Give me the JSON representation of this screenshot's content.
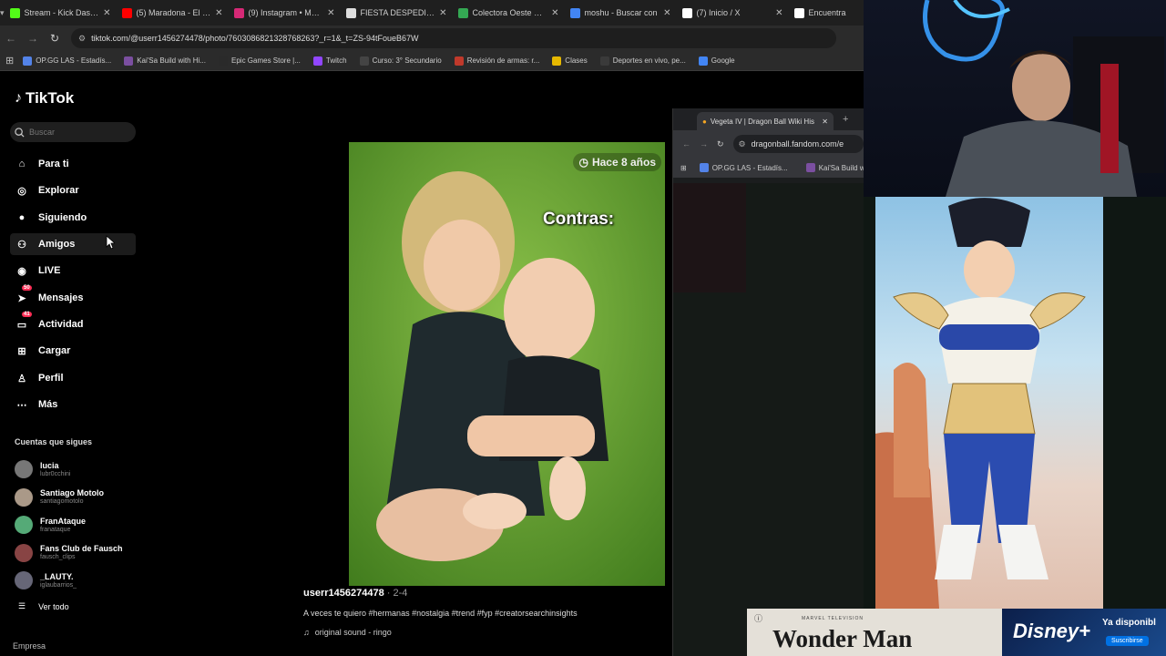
{
  "browser": {
    "tabs": [
      {
        "title": "Stream - Kick Dashbo",
        "icon": "kick-icon",
        "color": "#53fc18"
      },
      {
        "title": "(5) Maradona - El me",
        "icon": "youtube-icon",
        "color": "#ff0000"
      },
      {
        "title": "(9) Instagram • Mens",
        "icon": "instagram-icon",
        "color": "#d62976"
      },
      {
        "title": "FIESTA DESPEDIDA DE",
        "icon": "feather-icon",
        "color": "#dddddd"
      },
      {
        "title": "Colectora Oeste Ram",
        "icon": "maps-pin-icon",
        "color": "#34a853"
      },
      {
        "title": "moshu - Buscar con",
        "icon": "google-icon",
        "color": "#4285f4"
      },
      {
        "title": "(7) Inicio / X",
        "icon": "x-icon",
        "color": "#ffffff"
      },
      {
        "title": "Encuentra",
        "icon": "tiktok-icon",
        "color": "#ffffff"
      }
    ],
    "url": "tiktok.com/@userr1456274478/photo/7603086821328768263?_r=1&_t=ZS-94tFoueB67W",
    "bookmarks": [
      "OP.GG LAS - Estadís...",
      "Kai'Sa Build with Hi...",
      "Epic Games Store |...",
      "Twitch",
      "Curso: 3° Secundario",
      "Revisión de armas: r...",
      "Clases",
      "Deportes en vivo, pe...",
      "Google"
    ]
  },
  "tiktok": {
    "logo": "TikTok",
    "search_placeholder": "Buscar",
    "nav": [
      {
        "label": "Para ti",
        "icon": "home-icon"
      },
      {
        "label": "Explorar",
        "icon": "compass-icon"
      },
      {
        "label": "Siguiendo",
        "icon": "avatar-icon"
      },
      {
        "label": "Amigos",
        "icon": "friends-icon"
      },
      {
        "label": "LIVE",
        "icon": "live-icon"
      },
      {
        "label": "Mensajes",
        "icon": "paper-plane-icon",
        "badge": "50"
      },
      {
        "label": "Actividad",
        "icon": "inbox-icon",
        "badge": "41"
      },
      {
        "label": "Cargar",
        "icon": "plus-square-icon"
      },
      {
        "label": "Perfil",
        "icon": "person-icon"
      },
      {
        "label": "Más",
        "icon": "more-icon"
      }
    ],
    "following_title": "Cuentas que sigues",
    "following": [
      {
        "name": "lucia",
        "handle": "lubr0cchini"
      },
      {
        "name": "Santiago Motolo",
        "handle": "santiagomotolo"
      },
      {
        "name": "FranAtaque",
        "handle": "franataque"
      },
      {
        "name": "Fans Club de Fausch",
        "handle": "fausch_clips"
      },
      {
        "name": "_LAUTY.",
        "handle": "iglaubarrios_"
      }
    ],
    "see_all": "Ver todo",
    "footer": "Empresa"
  },
  "post": {
    "time_chip": "Hace 8 años",
    "overlay_text": "Contras:",
    "username": "userr1456274478",
    "date": " · 2-4",
    "caption": "A veces te quiero #hermanas #nostalgia #trend #fyp #creatorsearchinsights",
    "sound": "original sound - ringo"
  },
  "second_window": {
    "tab_title": "Vegeta IV | Dragon Ball Wiki His",
    "url": "dragonball.fandom.com/e",
    "bookmarks": [
      "OP.GG LAS - Estadís...",
      "Kai'Sa Build wit"
    ]
  },
  "ad": {
    "tag": "MARVEL TELEVISION",
    "title": "Wonder Man",
    "brand": "Disney+",
    "available": "Ya disponibl",
    "subscribe": "Suscribirse"
  }
}
